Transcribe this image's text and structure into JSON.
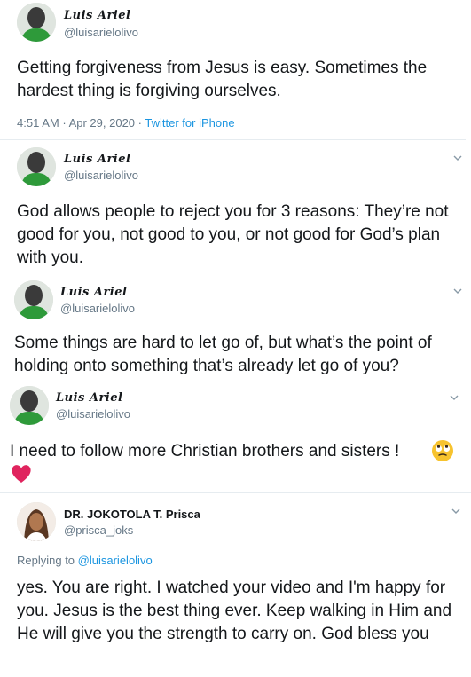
{
  "tweets": [
    {
      "name": "Luis Ariel",
      "handle": "@luisarielolivo",
      "text": "Getting forgiveness from Jesus is easy. Sometimes the hardest thing is forgiving ourselves.",
      "time": "4:51 AM",
      "date": "Apr 29, 2020",
      "source": "Twitter for iPhone"
    },
    {
      "name": "Luis Ariel",
      "handle": "@luisarielolivo",
      "text": "God allows people to reject you for 3 reasons: They’re not good for you, not good to you, or not good for God’s plan with you."
    },
    {
      "name": "Luis Ariel",
      "handle": "@luisarielolivo",
      "text": "Some things are hard to let go of, but what’s the point of holding onto something that’s already let go of you?"
    },
    {
      "name": "Luis Ariel",
      "handle": "@luisarielolivo",
      "text": "I need to follow more Christian brothers and sisters !"
    },
    {
      "name": "DR. JOKOTOLA T. Prisca",
      "handle": "@prisca_joks",
      "replying_label": "Replying to",
      "replying_to": "@luisarielolivo",
      "text": "yes. You are right. I watched your video and I'm happy for you. Jesus is the best thing ever. Keep walking in Him and He will give you the strength to carry on. God bless you"
    }
  ],
  "meta_separator": "·",
  "icons": {
    "caret": "chevron-down-icon",
    "emoji_1": "face-with-rolling-eyes-emoji",
    "emoji_2": "red-heart-emoji"
  },
  "colors": {
    "link": "#1b95e0",
    "secondary": "#657786",
    "heart": "#e0245e",
    "emoji_face": "#f7c32e"
  }
}
